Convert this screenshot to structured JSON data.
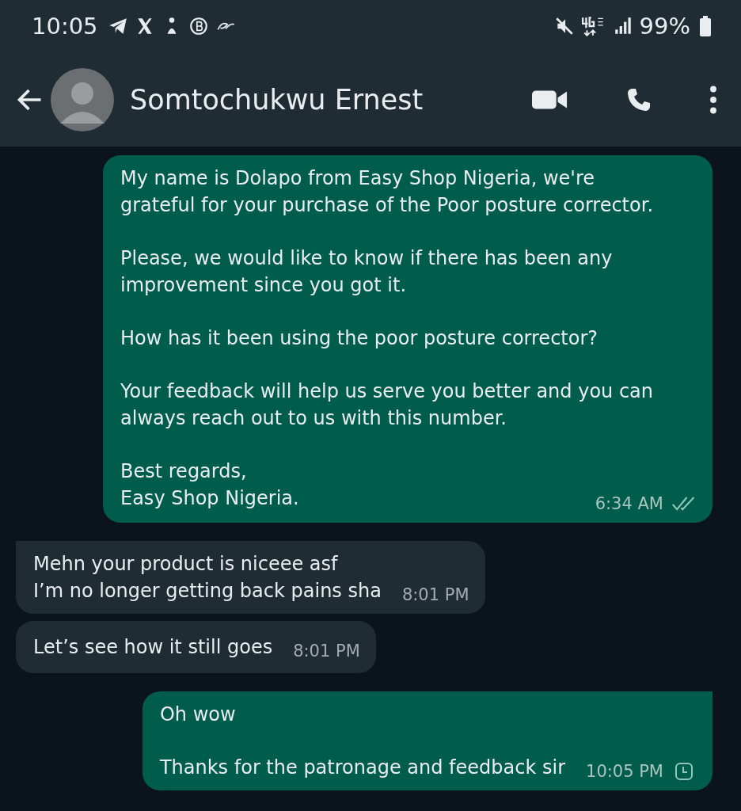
{
  "status_bar": {
    "time": "10:05",
    "battery": "99%"
  },
  "header": {
    "contact_name": "Somtochukwu Ernest"
  },
  "messages": [
    {
      "kind": "outgoing",
      "paragraphs": [
        "My name is Dolapo from Easy Shop Nigeria, we're grateful for your purchase of the Poor posture corrector.",
        "Please, we would like to know if there has been any improvement since you got it.",
        "How has it been using the poor posture corrector?",
        "Your feedback will help us serve you better and you can always reach out to us with this number.",
        "Best regards,\nEasy Shop Nigeria."
      ],
      "time": "6:34 AM",
      "read": true
    },
    {
      "kind": "incoming",
      "tail": true,
      "paragraphs": [
        "Mehn your product is niceee asf\nI’m no longer getting back pains sha"
      ],
      "time": "8:01 PM"
    },
    {
      "kind": "incoming",
      "tail": false,
      "paragraphs": [
        "Let’s see how it still goes"
      ],
      "time": "8:01 PM"
    },
    {
      "kind": "outgoing",
      "tail": true,
      "paragraphs": [
        "Oh wow",
        "Thanks for the patronage and feedback sir"
      ],
      "time": "10:05 PM",
      "read": false,
      "pending": true
    }
  ]
}
